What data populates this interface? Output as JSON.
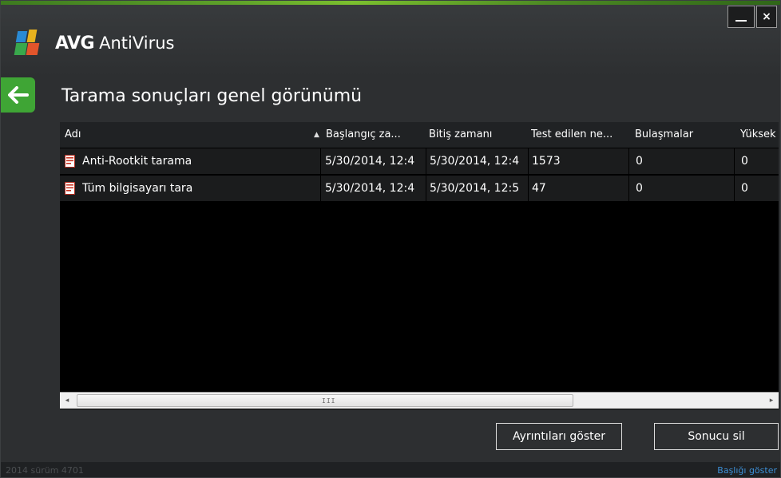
{
  "app": {
    "brand": "AVG",
    "product": "AntiVirus",
    "window_controls": {
      "minimize": "minimize",
      "close": "×"
    }
  },
  "page": {
    "title": "Tarama sonuçları genel görünümü"
  },
  "table": {
    "columns": [
      {
        "label": "Adı",
        "sorted": "ascending"
      },
      {
        "label": "Başlangıç za..."
      },
      {
        "label": "Bitiş zamanı"
      },
      {
        "label": "Test edilen ne..."
      },
      {
        "label": "Bulaşmalar"
      },
      {
        "label": "Yüksek"
      }
    ],
    "rows": [
      {
        "name": "Anti-Rootkit tarama",
        "start": "5/30/2014, 12:4",
        "end": "5/30/2014, 12:4",
        "tested": "1573",
        "infections": "0",
        "high": "0"
      },
      {
        "name": "Tüm bilgisayarı tara",
        "start": "5/30/2014, 12:4",
        "end": "5/30/2014, 12:5",
        "tested": "47",
        "infections": "0",
        "high": "0"
      }
    ],
    "sort_arrow": "▲",
    "scroll": {
      "left": "◂",
      "right": "▸",
      "grip": "III"
    }
  },
  "buttons": {
    "details": "Ayrıntıları göster",
    "delete": "Sonucu sil"
  },
  "footer": {
    "version": "2014  sürüm 4701",
    "show_header": "Başlığı göster"
  },
  "colors": {
    "accent_green": "#3fa535",
    "link_blue": "#3c8fd6",
    "background": "#2d2f31",
    "table_bg": "#000000"
  }
}
